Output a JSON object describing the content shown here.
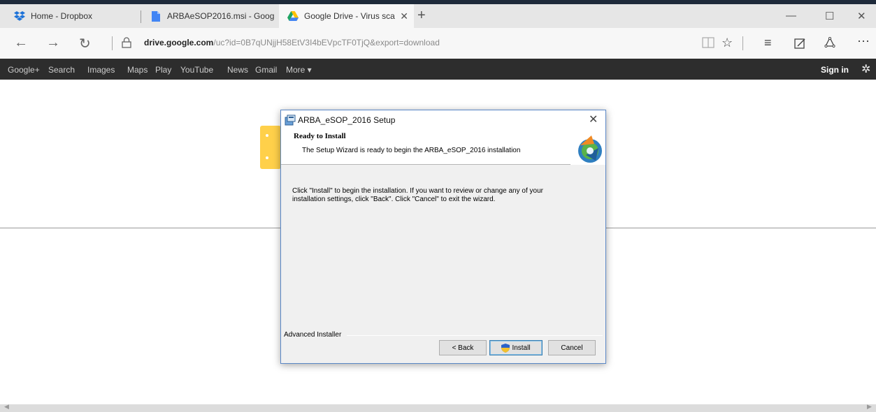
{
  "tabs": [
    {
      "label": "Home - Dropbox",
      "icon": "dropbox-icon"
    },
    {
      "label": "ARBAeSOP2016.msi - Goog",
      "icon": "google-docs-file-icon"
    },
    {
      "label": "Google Drive - Virus sca",
      "icon": "google-drive-icon",
      "active": true
    }
  ],
  "address": {
    "domain": "drive.google.com",
    "path": "/uc?id=0B7qUNjjH58EtV3I4bEVpcTF0TjQ&export=download"
  },
  "google_bar": {
    "links": [
      "Google+",
      "Search",
      "Images",
      "Maps",
      "Play",
      "YouTube",
      "News",
      "Gmail",
      "More ▾"
    ],
    "sign_in": "Sign in"
  },
  "dialog": {
    "title": "ARBA_eSOP_2016 Setup",
    "header_title": "Ready to Install",
    "header_subtitle": "The Setup Wizard is ready to begin the ARBA_eSOP_2016 installation",
    "body_line1": "Click \"Install\" to begin the installation.  If you want to review or change any of your",
    "body_line2": "installation settings, click \"Back\".  Click \"Cancel\" to exit the wizard.",
    "group_label": "Advanced Installer",
    "back_label": "< Back",
    "install_label": "Install",
    "cancel_label": "Cancel"
  },
  "colors": {
    "accent": "#3c7fb1",
    "gbar": "#2d2d2d",
    "drive_yellow": "#ffd04a"
  }
}
